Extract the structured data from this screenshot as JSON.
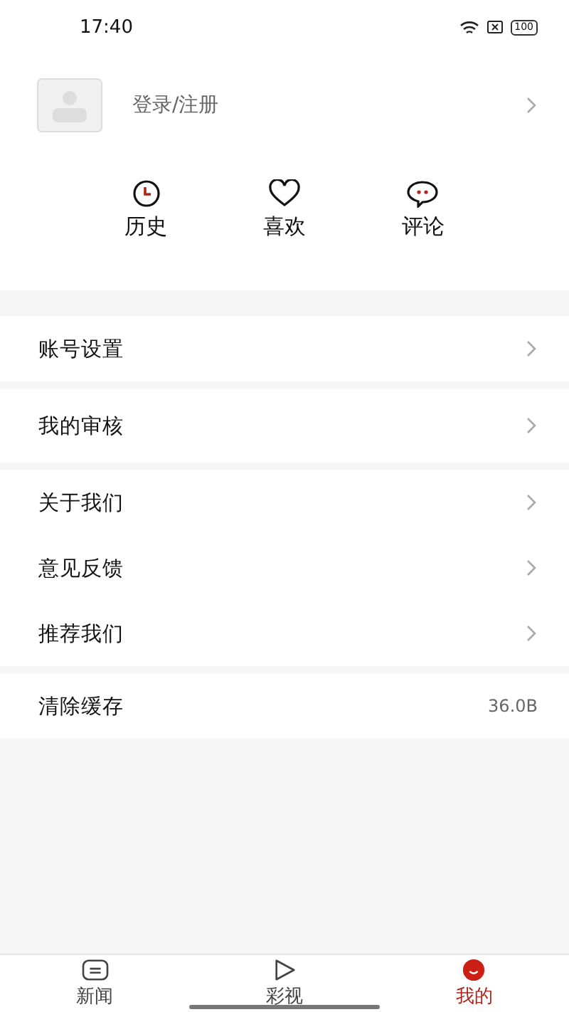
{
  "status_bar": {
    "time": "17:40",
    "battery": "100"
  },
  "profile": {
    "label": "登录/注册"
  },
  "quick_actions": [
    {
      "kind": "history",
      "label": "历史"
    },
    {
      "kind": "favorite",
      "label": "喜欢"
    },
    {
      "kind": "comment",
      "label": "评论"
    }
  ],
  "menu_groups": [
    [
      {
        "kind": "link",
        "label": "账号设置"
      }
    ],
    [
      {
        "kind": "link",
        "label": "我的审核"
      }
    ],
    [
      {
        "kind": "link",
        "label": "关于我们"
      },
      {
        "kind": "link",
        "label": "意见反馈"
      },
      {
        "kind": "link",
        "label": "推荐我们"
      }
    ],
    [
      {
        "kind": "value",
        "label": "清除缓存",
        "value": "36.0B"
      }
    ]
  ],
  "tab_bar": [
    {
      "kind": "news",
      "label": "新闻",
      "selected": false
    },
    {
      "kind": "video",
      "label": "彩视",
      "selected": false
    },
    {
      "kind": "me",
      "label": "我的",
      "selected": true
    }
  ]
}
